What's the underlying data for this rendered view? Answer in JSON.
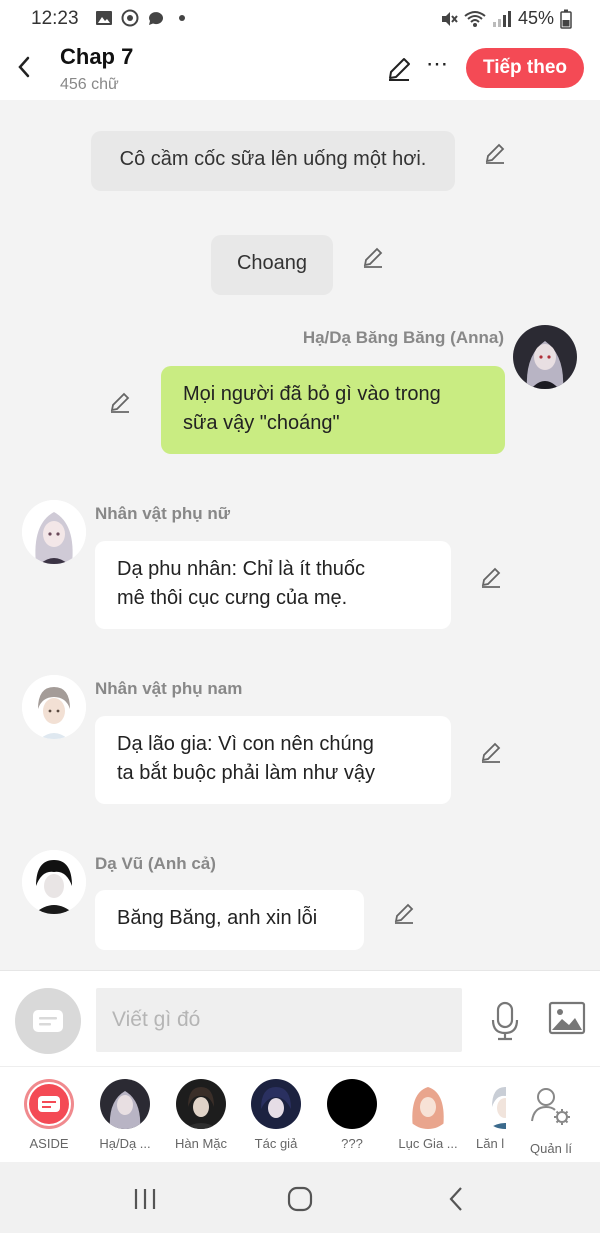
{
  "status": {
    "time": "12:23",
    "battery": "45%"
  },
  "header": {
    "title": "Chap 7",
    "subtitle": "456 chữ",
    "next_label": "Tiếp theo"
  },
  "messages": {
    "m1": {
      "text": "Cô cầm cốc sữa lên uống một hơi."
    },
    "m2": {
      "text": "Choang"
    },
    "m3": {
      "name": "Hạ/Dạ Băng Băng (Anna)",
      "text_line1": "Mọi người đã bỏ gì vào trong",
      "text_line2": "sữa vậy \"choáng\""
    },
    "m4": {
      "name": "Nhân vật phụ nữ",
      "text_line1": "Dạ phu nhân: Chỉ là ít thuốc",
      "text_line2": "mê thôi cục cưng của mẹ."
    },
    "m5": {
      "name": "Nhân vật phụ nam",
      "text_line1": "Dạ lão gia: Vì con nên chúng",
      "text_line2": "ta bắt buộc phải làm như vậy"
    },
    "m6": {
      "name": "Dạ Vũ (Anh cả)",
      "text": "Băng Băng, anh xin lỗi"
    }
  },
  "input": {
    "placeholder": "Viết gì đó"
  },
  "characters": [
    {
      "label": "ASIDE"
    },
    {
      "label": "Hạ/Dạ ..."
    },
    {
      "label": "Hàn Mặc"
    },
    {
      "label": "Tác giả"
    },
    {
      "label": "???"
    },
    {
      "label": "Lục Gia ..."
    },
    {
      "label": "Lăn l"
    },
    {
      "label": "Quản lí"
    }
  ],
  "colors": {
    "accent": "#f44a55",
    "my_bubble": "#c9ec82",
    "narration_bubble": "#e8e8e8"
  }
}
